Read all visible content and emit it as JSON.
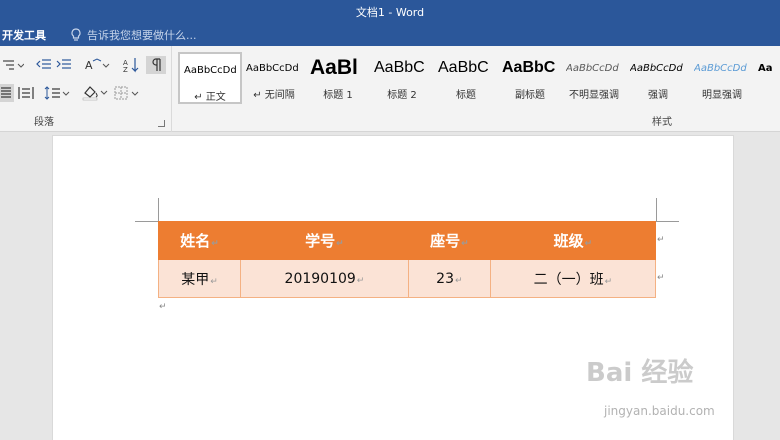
{
  "window": {
    "title": "文档1 - Word"
  },
  "tabs": {
    "developer": "开发工具",
    "tell_me": "告诉我您想要做什么..."
  },
  "ribbon": {
    "paragraph_group_label": "段落",
    "styles_group_label": "样式",
    "styles": [
      {
        "preview": "AaBbCcDd",
        "name": "↵ 正文",
        "selected": true
      },
      {
        "preview": "AaBbCcDd",
        "name": "↵ 无间隔"
      },
      {
        "preview": "AaBl",
        "name": "标题 1"
      },
      {
        "preview": "AaBbC",
        "name": "标题 2"
      },
      {
        "preview": "AaBbC",
        "name": "标题"
      },
      {
        "preview": "AaBbC",
        "name": "副标题"
      },
      {
        "preview": "AaBbCcDd",
        "name": "不明显强调"
      },
      {
        "preview": "AaBbCcDd",
        "name": "强调"
      },
      {
        "preview": "AaBbCcDd",
        "name": "明显强调"
      },
      {
        "preview": "Aa",
        "name": ""
      }
    ]
  },
  "document": {
    "table": {
      "headers": [
        "姓名",
        "学号",
        "座号",
        "班级"
      ],
      "rows": [
        [
          "某甲",
          "20190109",
          "23",
          "二（一）班"
        ]
      ]
    }
  },
  "watermark": {
    "text": "Bai 经验",
    "url": "jingyan.baidu.com"
  },
  "colors": {
    "titlebar": "#2b579a",
    "table_header": "#ed7d31",
    "table_row": "#fbe3d6",
    "table_border": "#f4b183"
  }
}
